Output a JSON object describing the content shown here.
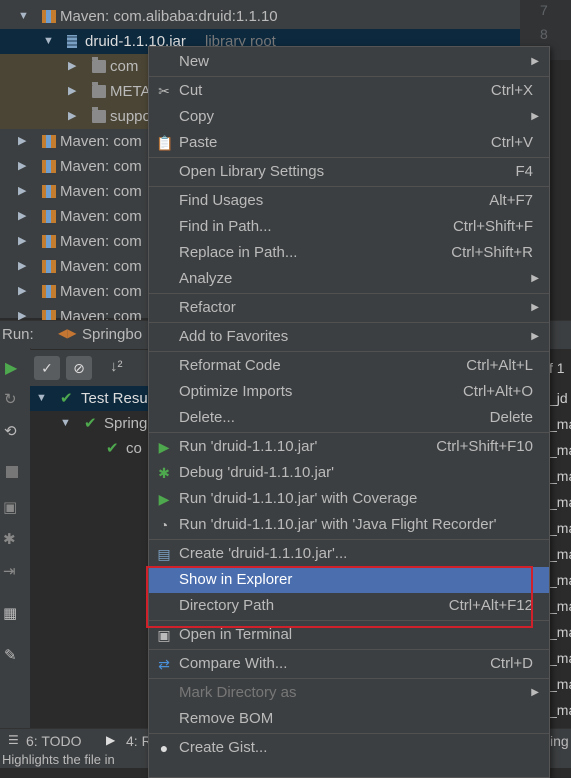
{
  "project_tree": {
    "rows": [
      {
        "label": "Maven: com.alibaba:druid:1.1.10",
        "icon": "maven-library-icon",
        "expanded": true
      },
      {
        "label": "druid-1.1.10.jar",
        "suffix": "library root",
        "icon": "jar-icon",
        "expanded": true
      },
      {
        "label": "com",
        "icon": "package-icon"
      },
      {
        "label": "META",
        "icon": "folder-icon"
      },
      {
        "label": "suppo",
        "icon": "package-icon"
      },
      {
        "label": "Maven: com",
        "icon": "maven-library-icon"
      },
      {
        "label": "Maven: com",
        "icon": "maven-library-icon"
      },
      {
        "label": "Maven: com",
        "icon": "maven-library-icon"
      },
      {
        "label": "Maven: com",
        "icon": "maven-library-icon"
      },
      {
        "label": "Maven: com",
        "icon": "maven-library-icon"
      },
      {
        "label": "Maven: com",
        "icon": "maven-library-icon"
      },
      {
        "label": "Maven: com",
        "icon": "maven-library-icon"
      },
      {
        "label": "Maven: com",
        "icon": "maven-library-icon"
      }
    ]
  },
  "gutter": {
    "lines": [
      "7",
      "8"
    ]
  },
  "run_panel": {
    "title": "Run:",
    "tab_label": "Springbo",
    "test_tree": [
      {
        "label": "Test Resu",
        "status": "passed"
      },
      {
        "label": "Spring",
        "status": "passed"
      },
      {
        "label": "co",
        "status": "passed"
      }
    ],
    "console_lines": [
      "f 1",
      "_jd",
      "_ma",
      "_ma",
      "_ma",
      "_ma",
      "_ma",
      "_ma",
      "_ma",
      "_ma",
      "_ma",
      "_ma",
      "_ma",
      "_ma"
    ]
  },
  "bottom_bar": {
    "todo": "6: TODO",
    "run": "4: R",
    "right_text": "ing"
  },
  "status_bar": {
    "text": "Highlights the file in"
  },
  "context_menu": {
    "items": [
      {
        "label": "New",
        "submenu": true
      },
      {
        "separator": true
      },
      {
        "label": "Cut",
        "mnemonic": "t",
        "shortcut": "Ctrl+X",
        "icon": "scissors-icon"
      },
      {
        "label": "Copy",
        "mnemonic": "C",
        "submenu": true
      },
      {
        "label": "Paste",
        "mnemonic": "P",
        "shortcut": "Ctrl+V",
        "icon": "clipboard-icon"
      },
      {
        "separator": true
      },
      {
        "label": "Open Library Settings",
        "shortcut": "F4"
      },
      {
        "separator": true
      },
      {
        "label": "Find Usages",
        "mnemonic": "U",
        "shortcut": "Alt+F7"
      },
      {
        "label": "Find in Path...",
        "mnemonic": "P",
        "shortcut": "Ctrl+Shift+F"
      },
      {
        "label": "Replace in Path...",
        "mnemonic": "a",
        "shortcut": "Ctrl+Shift+R"
      },
      {
        "label": "Analyze",
        "mnemonic": "z",
        "submenu": true
      },
      {
        "separator": true
      },
      {
        "label": "Refactor",
        "mnemonic": "R",
        "submenu": true
      },
      {
        "separator": true
      },
      {
        "label": "Add to Favorites",
        "mnemonic": "a",
        "submenu": true
      },
      {
        "separator": true
      },
      {
        "label": "Reformat Code",
        "mnemonic": "R",
        "shortcut": "Ctrl+Alt+L"
      },
      {
        "label": "Optimize Imports",
        "mnemonic": "z",
        "shortcut": "Ctrl+Alt+O"
      },
      {
        "label": "Delete...",
        "mnemonic": "D",
        "shortcut": "Delete"
      },
      {
        "separator": true
      },
      {
        "label": "Run 'druid-1.1.10.jar'",
        "mnemonic": "u",
        "shortcut": "Ctrl+Shift+F10",
        "icon": "run-icon"
      },
      {
        "label": "Debug 'druid-1.1.10.jar'",
        "mnemonic": "D",
        "icon": "debug-icon"
      },
      {
        "label": "Run 'druid-1.1.10.jar' with Coverage",
        "mnemonic": "v",
        "icon": "coverage-icon"
      },
      {
        "label": "Run 'druid-1.1.10.jar' with 'Java Flight Recorder'",
        "icon": "flight-recorder-icon"
      },
      {
        "separator": true
      },
      {
        "label": "Create 'druid-1.1.10.jar'...",
        "icon": "create-config-icon"
      },
      {
        "label": "Show in Explorer",
        "highlighted": true
      },
      {
        "label": "Directory Path",
        "shortcut": "Ctrl+Alt+F12"
      },
      {
        "separator": true
      },
      {
        "label": "Open in Terminal",
        "icon": "terminal-icon"
      },
      {
        "separator": true
      },
      {
        "label": "Compare With...",
        "shortcut": "Ctrl+D",
        "icon": "compare-icon"
      },
      {
        "separator": true
      },
      {
        "label": "Mark Directory as",
        "disabled": true,
        "submenu": true
      },
      {
        "label": "Remove BOM"
      },
      {
        "separator": true
      },
      {
        "label": "Create Gist...",
        "icon": "github-icon"
      }
    ]
  },
  "colors": {
    "highlight": "#4b6eaf",
    "annotation": "#d0202a",
    "menu_bg": "#3c3f41"
  }
}
